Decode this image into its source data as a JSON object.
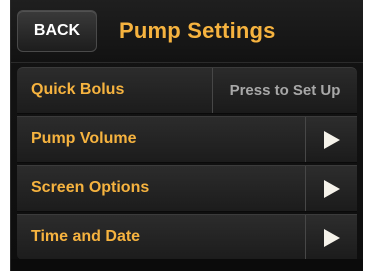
{
  "header": {
    "back_label": "BACK",
    "title": "Pump Settings"
  },
  "menu": {
    "items": [
      {
        "label": "Quick Bolus",
        "value": "Press to Set Up"
      },
      {
        "label": "Pump Volume",
        "icon": "chevron-right-icon"
      },
      {
        "label": "Screen Options",
        "icon": "chevron-right-icon"
      },
      {
        "label": "Time and Date",
        "icon": "chevron-right-icon"
      }
    ]
  },
  "colors": {
    "accent": "#f6b33f",
    "background": "#141414",
    "value_text": "#a8a8a8",
    "arrow": "#f5f2ea"
  }
}
